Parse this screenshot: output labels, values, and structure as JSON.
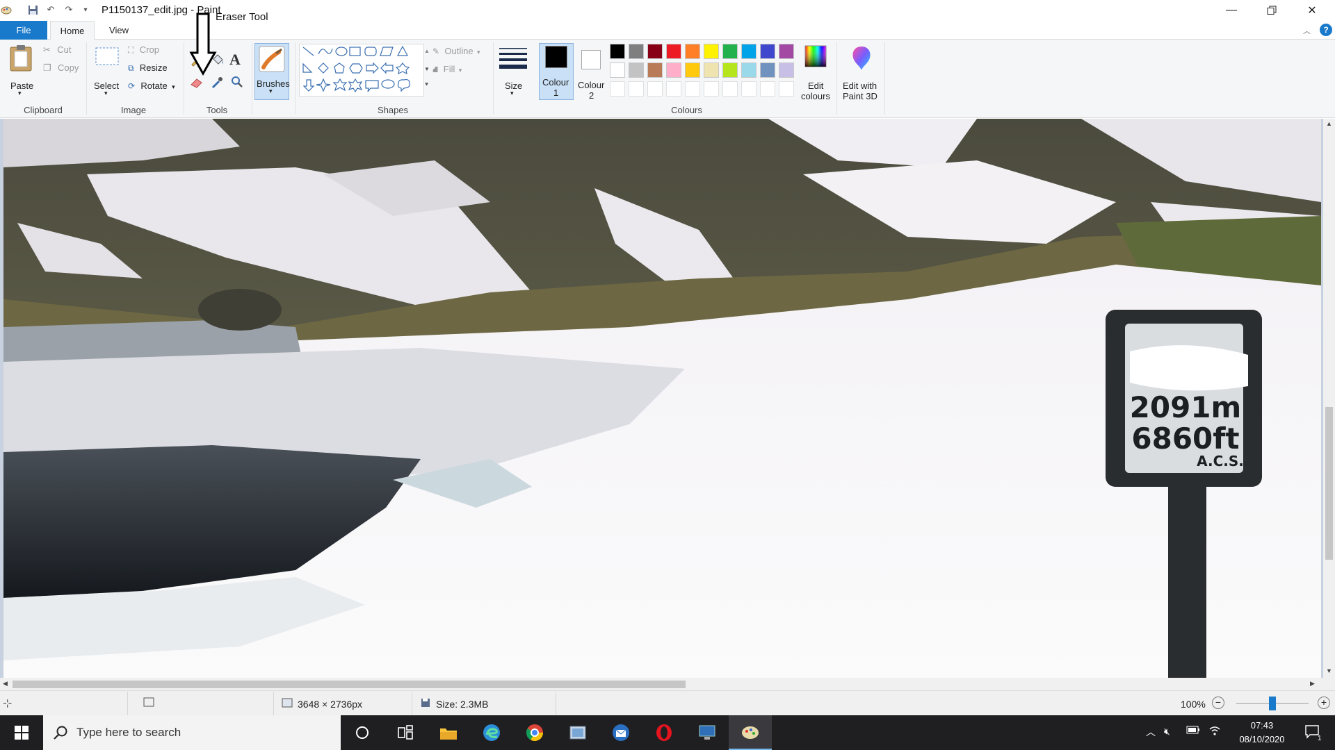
{
  "window": {
    "title": "P1150137_edit.jpg - Paint"
  },
  "annotation": {
    "label": "Eraser Tool"
  },
  "tabs": {
    "file": "File",
    "home": "Home",
    "view": "View"
  },
  "clipboard": {
    "paste": "Paste",
    "cut": "Cut",
    "copy": "Copy",
    "label": "Clipboard"
  },
  "image": {
    "select": "Select",
    "crop": "Crop",
    "resize": "Resize",
    "rotate": "Rotate",
    "label": "Image"
  },
  "tools": {
    "label": "Tools",
    "text_glyph": "A"
  },
  "brushes": {
    "label": "Brushes"
  },
  "shapes": {
    "outline": "Outline",
    "fill": "Fill",
    "label": "Shapes"
  },
  "size": {
    "label": "Size"
  },
  "colours": {
    "colour1": "Colour\n1",
    "colour1_a": "Colour",
    "colour1_b": "1",
    "colour2_a": "Colour",
    "colour2_b": "2",
    "edit_a": "Edit",
    "edit_b": "colours",
    "label": "Colours",
    "row1": [
      "#000000",
      "#7f7f7f",
      "#880015",
      "#ed1c24",
      "#ff7f27",
      "#fff200",
      "#22b14c",
      "#00a2e8",
      "#3f48cc",
      "#a349a4"
    ],
    "row2": [
      "#ffffff",
      "#c3c3c3",
      "#b97a57",
      "#ffaec9",
      "#ffc90e",
      "#efe4b0",
      "#b5e61d",
      "#99d9ea",
      "#7092be",
      "#c8bfe7"
    ]
  },
  "paint3d": {
    "a": "Edit with",
    "b": "Paint 3D"
  },
  "sign": {
    "line1": "2091m",
    "line2": "6860ft",
    "line3": "A.C.S."
  },
  "status": {
    "dimensions": "3648 × 2736px",
    "size": "Size: 2.3MB",
    "zoom": "100%",
    "zoom_fraction": 0.5
  },
  "taskbar": {
    "search_placeholder": "Type here to search",
    "time": "07:43",
    "date": "08/10/2020",
    "notifications": "1"
  }
}
